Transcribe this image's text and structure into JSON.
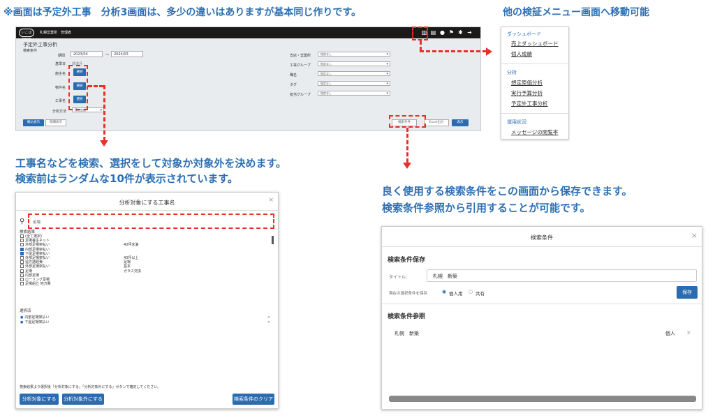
{
  "captions": {
    "top_left": "※画面は予定外工事　分析3画面は、多少の違いはありますが基本同じ作りです。",
    "top_right": "他の検証メニュー画面へ移動可能",
    "mid_left_1": "工事名などを検索、選択をして対象か対象外を決めます。",
    "mid_left_2": "検索前はランダムな10件が表示されています。",
    "mid_right_1": "良く使用する検索条件をこの画面から保存できます。",
    "mid_right_2": "検索条件参照から引用することが可能です。"
  },
  "main": {
    "logo": "いこはOFCS",
    "company": "札幌営業所",
    "user": "管理者",
    "title": "予定外工事分析",
    "subtitle": "検索条件",
    "period_label": "期間",
    "date_from": "2023/04",
    "tilde": "～",
    "date_to": "2024/03",
    "base_label": "基準日",
    "base_value": "請求月",
    "owner_label": "施主名",
    "property_label": "物件名",
    "work_label": "工事名",
    "select_label": "選択",
    "method_label": "分析方法",
    "method_value": "積込金額",
    "right_fields": [
      {
        "label": "支店・営業所",
        "value": "指定なし"
      },
      {
        "label": "工事グループ",
        "value": "指定なし"
      },
      {
        "label": "職名",
        "value": "指定なし"
      },
      {
        "label": "タグ",
        "value": "指定なし"
      },
      {
        "label": "担当グループ",
        "value": "指定なし"
      }
    ],
    "btn_overview": "概込表示",
    "btn_detail": "明細表示",
    "btn_search_cond": "検索条件",
    "btn_excel": "Excel出力",
    "btn_show": "表示"
  },
  "menu": {
    "sections": [
      {
        "header": "ダッシュボード",
        "items": [
          "売上ダッシュボード",
          "個人成績"
        ]
      },
      {
        "header": "分析",
        "items": [
          "想定原価分析",
          "実行予算分析",
          "予定外工事分析"
        ]
      },
      {
        "header": "運用状況",
        "items": [
          "メッセージの閲覧率"
        ]
      }
    ]
  },
  "modal1": {
    "title": "分析対象にする工事名",
    "search_value": "足場",
    "results_label": "検索結果",
    "results": [
      {
        "label": "(全て選択)",
        "checked": false,
        "note": ""
      },
      {
        "label": "足場養生ネット",
        "checked": false,
        "note": ""
      },
      {
        "label": "外部足場架払い",
        "checked": false,
        "note": "40坪未満"
      },
      {
        "label": "内部足場架払い",
        "checked": true,
        "note": ""
      },
      {
        "label": "下屋足場架払い",
        "checked": true,
        "note": ""
      },
      {
        "label": "外部足場架払い",
        "checked": false,
        "note": "40坪以上"
      },
      {
        "label": "遠方諸経費",
        "checked": false,
        "note": "足場"
      },
      {
        "label": "外部足場架払い",
        "checked": false,
        "note": "基本"
      },
      {
        "label": "足場",
        "checked": false,
        "note": "ガラス交換"
      },
      {
        "label": "内部足場",
        "checked": false,
        "note": ""
      },
      {
        "label": "ローリング足場",
        "checked": false,
        "note": ""
      },
      {
        "label": "足場組立 地方費",
        "checked": false,
        "note": ""
      }
    ],
    "selected_label": "選択済",
    "selected": [
      "内部足場架払い",
      "下屋足場架払い"
    ],
    "hint": "検索結果より選択後「分析対象にする」「分析対象外にする」ボタンで確定してください。",
    "btn_target": "分析対象にする",
    "btn_exclude": "分析対象外にする",
    "btn_clear": "検索条件のクリア"
  },
  "modal2": {
    "title": "検索条件",
    "save_header": "検索条件保存",
    "title_label": "タイトル：",
    "title_value": "札幌　新築",
    "scope_label": "現在の選択条件を保存",
    "scope_personal": "個人用",
    "scope_shared": "共有",
    "btn_save": "保存",
    "ref_header": "検索条件参照",
    "ref_item": "札幌　新築",
    "ref_owner": "個人"
  }
}
